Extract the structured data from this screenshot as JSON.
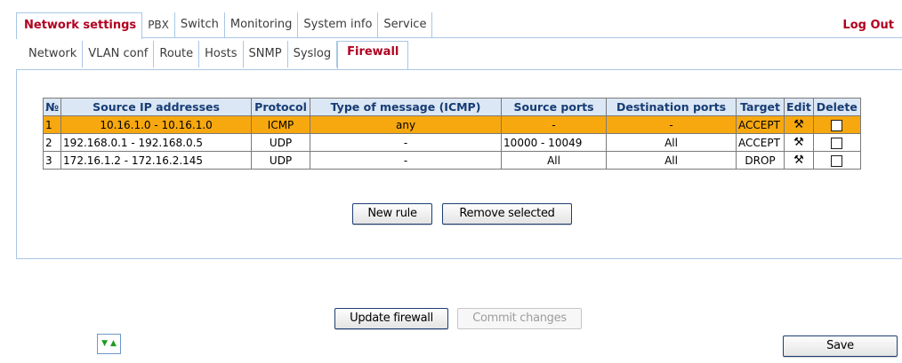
{
  "topnav": {
    "tabs": [
      "Network settings",
      "PBX",
      "Switch",
      "Monitoring",
      "System info",
      "Service"
    ],
    "logout": "Log Out"
  },
  "subnav": {
    "tabs": [
      "Network",
      "VLAN conf",
      "Route",
      "Hosts",
      "SNMP",
      "Syslog",
      "Firewall"
    ]
  },
  "table": {
    "headers": [
      "№",
      "Source IP addresses",
      "Protocol",
      "Type of message (ICMP)",
      "Source ports",
      "Destination ports",
      "Target",
      "Edit",
      "Delete"
    ],
    "rows": [
      {
        "num": "1",
        "source_ip": "10.16.1.0 - 10.16.1.0",
        "protocol": "ICMP",
        "icmp_type": "any",
        "src_ports": "-",
        "dst_ports": "-",
        "target": "ACCEPT",
        "selected": true
      },
      {
        "num": "2",
        "source_ip": "192.168.0.1 - 192.168.0.5",
        "protocol": "UDP",
        "icmp_type": "-",
        "src_ports": "10000 - 10049",
        "dst_ports": "All",
        "target": "ACCEPT",
        "selected": false
      },
      {
        "num": "3",
        "source_ip": "172.16.1.2 - 172.16.2.145",
        "protocol": "UDP",
        "icmp_type": "-",
        "src_ports": "All",
        "dst_ports": "All",
        "target": "DROP",
        "selected": false
      }
    ]
  },
  "buttons": {
    "new_rule": "New rule",
    "remove_selected": "Remove selected",
    "update_firewall": "Update firewall",
    "commit_changes": "Commit changes",
    "save": "Save"
  },
  "colors": {
    "active_tab": "#b00020",
    "selected_row": "#f7a80f",
    "header_text": "#173c74",
    "border_blue": "#a9c7e7"
  }
}
